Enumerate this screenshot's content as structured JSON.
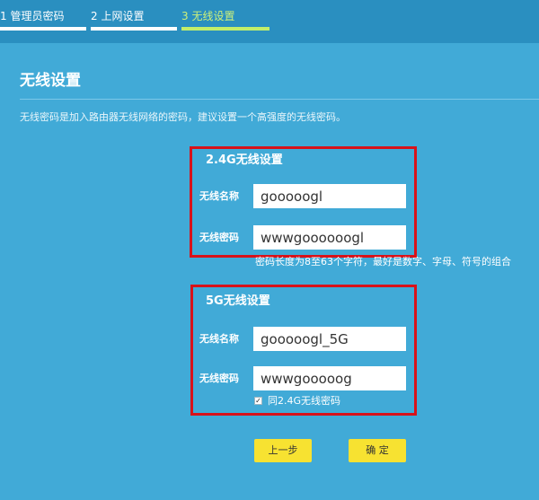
{
  "steps": [
    {
      "label": "1 管理员密码"
    },
    {
      "label": "2 上网设置"
    },
    {
      "label": "3 无线设置"
    }
  ],
  "page": {
    "title": "无线设置",
    "hint": "无线密码是加入路由器无线网络的密码，建议设置一个高强度的无线密码。"
  },
  "wifi24": {
    "title": "2.4G无线设置",
    "name_label": "无线名称",
    "name_value": "gooooogl",
    "password_label": "无线密码",
    "password_value": "wwwgoooooogl",
    "note": "密码长度为8至63个字符，最好是数字、字母、符号的组合"
  },
  "wifi5": {
    "title": "5G无线设置",
    "name_label": "无线名称",
    "name_value": "gooooogl_5G",
    "password_label": "无线密码",
    "password_value": "wwwgooooog",
    "same_password_label": "同2.4G无线密码",
    "same_password_checked": true
  },
  "buttons": {
    "prev": "上一步",
    "ok": "确 定"
  },
  "colors": {
    "background": "#41aad7",
    "header": "#2a8fc0",
    "active_step": "#c2ee6a",
    "highlight_border": "#d8121a",
    "button": "#f7e231"
  }
}
